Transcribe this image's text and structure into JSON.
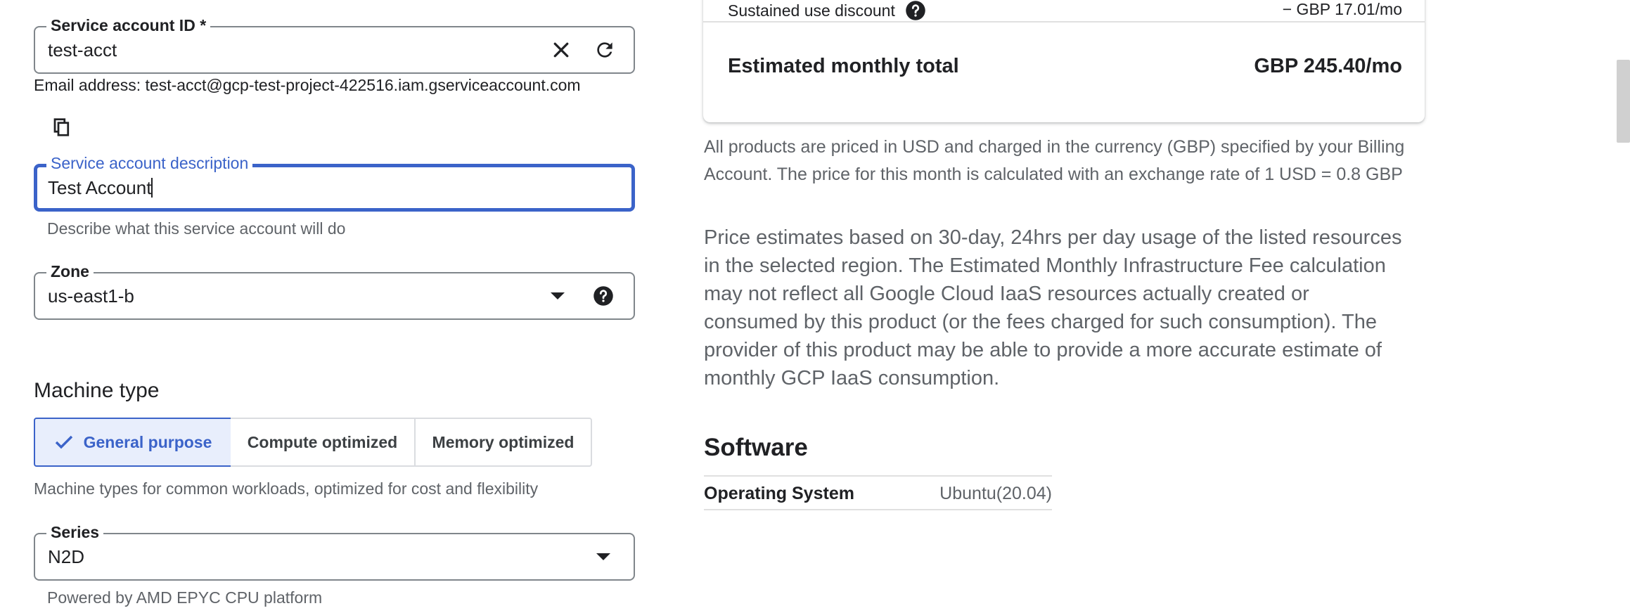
{
  "service_account": {
    "id_label": "Service account ID *",
    "id_value": "test-acct",
    "email_text": "Email address: test-acct@gcp-test-project-422516.iam.gserviceaccount.com",
    "description_label": "Service account description",
    "description_value": "Test Account",
    "description_helper": "Describe what this service account will do"
  },
  "zone": {
    "label": "Zone",
    "value": "us-east1-b"
  },
  "machine_type": {
    "heading": "Machine type",
    "tabs": [
      "General purpose",
      "Compute optimized",
      "Memory optimized"
    ],
    "selected": "General purpose",
    "helper": "Machine types for common workloads, optimized for cost and flexibility"
  },
  "series": {
    "label": "Series",
    "value": "N2D",
    "helper": "Powered by AMD EPYC CPU platform"
  },
  "pricing": {
    "sustained_label": "Sustained use discount",
    "sustained_value": "− GBP 17.01/mo",
    "total_label": "Estimated monthly total",
    "total_value": "GBP 245.40/mo",
    "currency_note": [
      "All products are priced in USD and charged in the currency (GBP) specified by your Billing",
      "Account. The price for this month is calculated with an exchange rate of 1 USD = 0.8 GBP"
    ],
    "estimate_note": [
      "Price estimates based on 30-day, 24hrs per day usage of the listed resources",
      "in the selected region. The Estimated Monthly Infrastructure Fee calculation",
      "may not reflect all Google Cloud IaaS resources actually created or",
      "consumed by this product (or the fees charged for such consumption). The",
      "provider of this product may be able to provide a more accurate estimate of",
      "monthly GCP IaaS consumption."
    ]
  },
  "software": {
    "heading": "Software",
    "rows": [
      {
        "label": "Operating System",
        "value": "Ubuntu(20.04)"
      }
    ]
  },
  "colors": {
    "accent": "#3b63c9",
    "selected_bg": "#e8eefc",
    "border": "#80868b"
  },
  "icons": {
    "clear": "close-icon",
    "refresh": "refresh-icon",
    "copy": "copy-icon",
    "dropdown": "chevron-down-icon",
    "help": "help-icon",
    "check": "check-icon"
  }
}
